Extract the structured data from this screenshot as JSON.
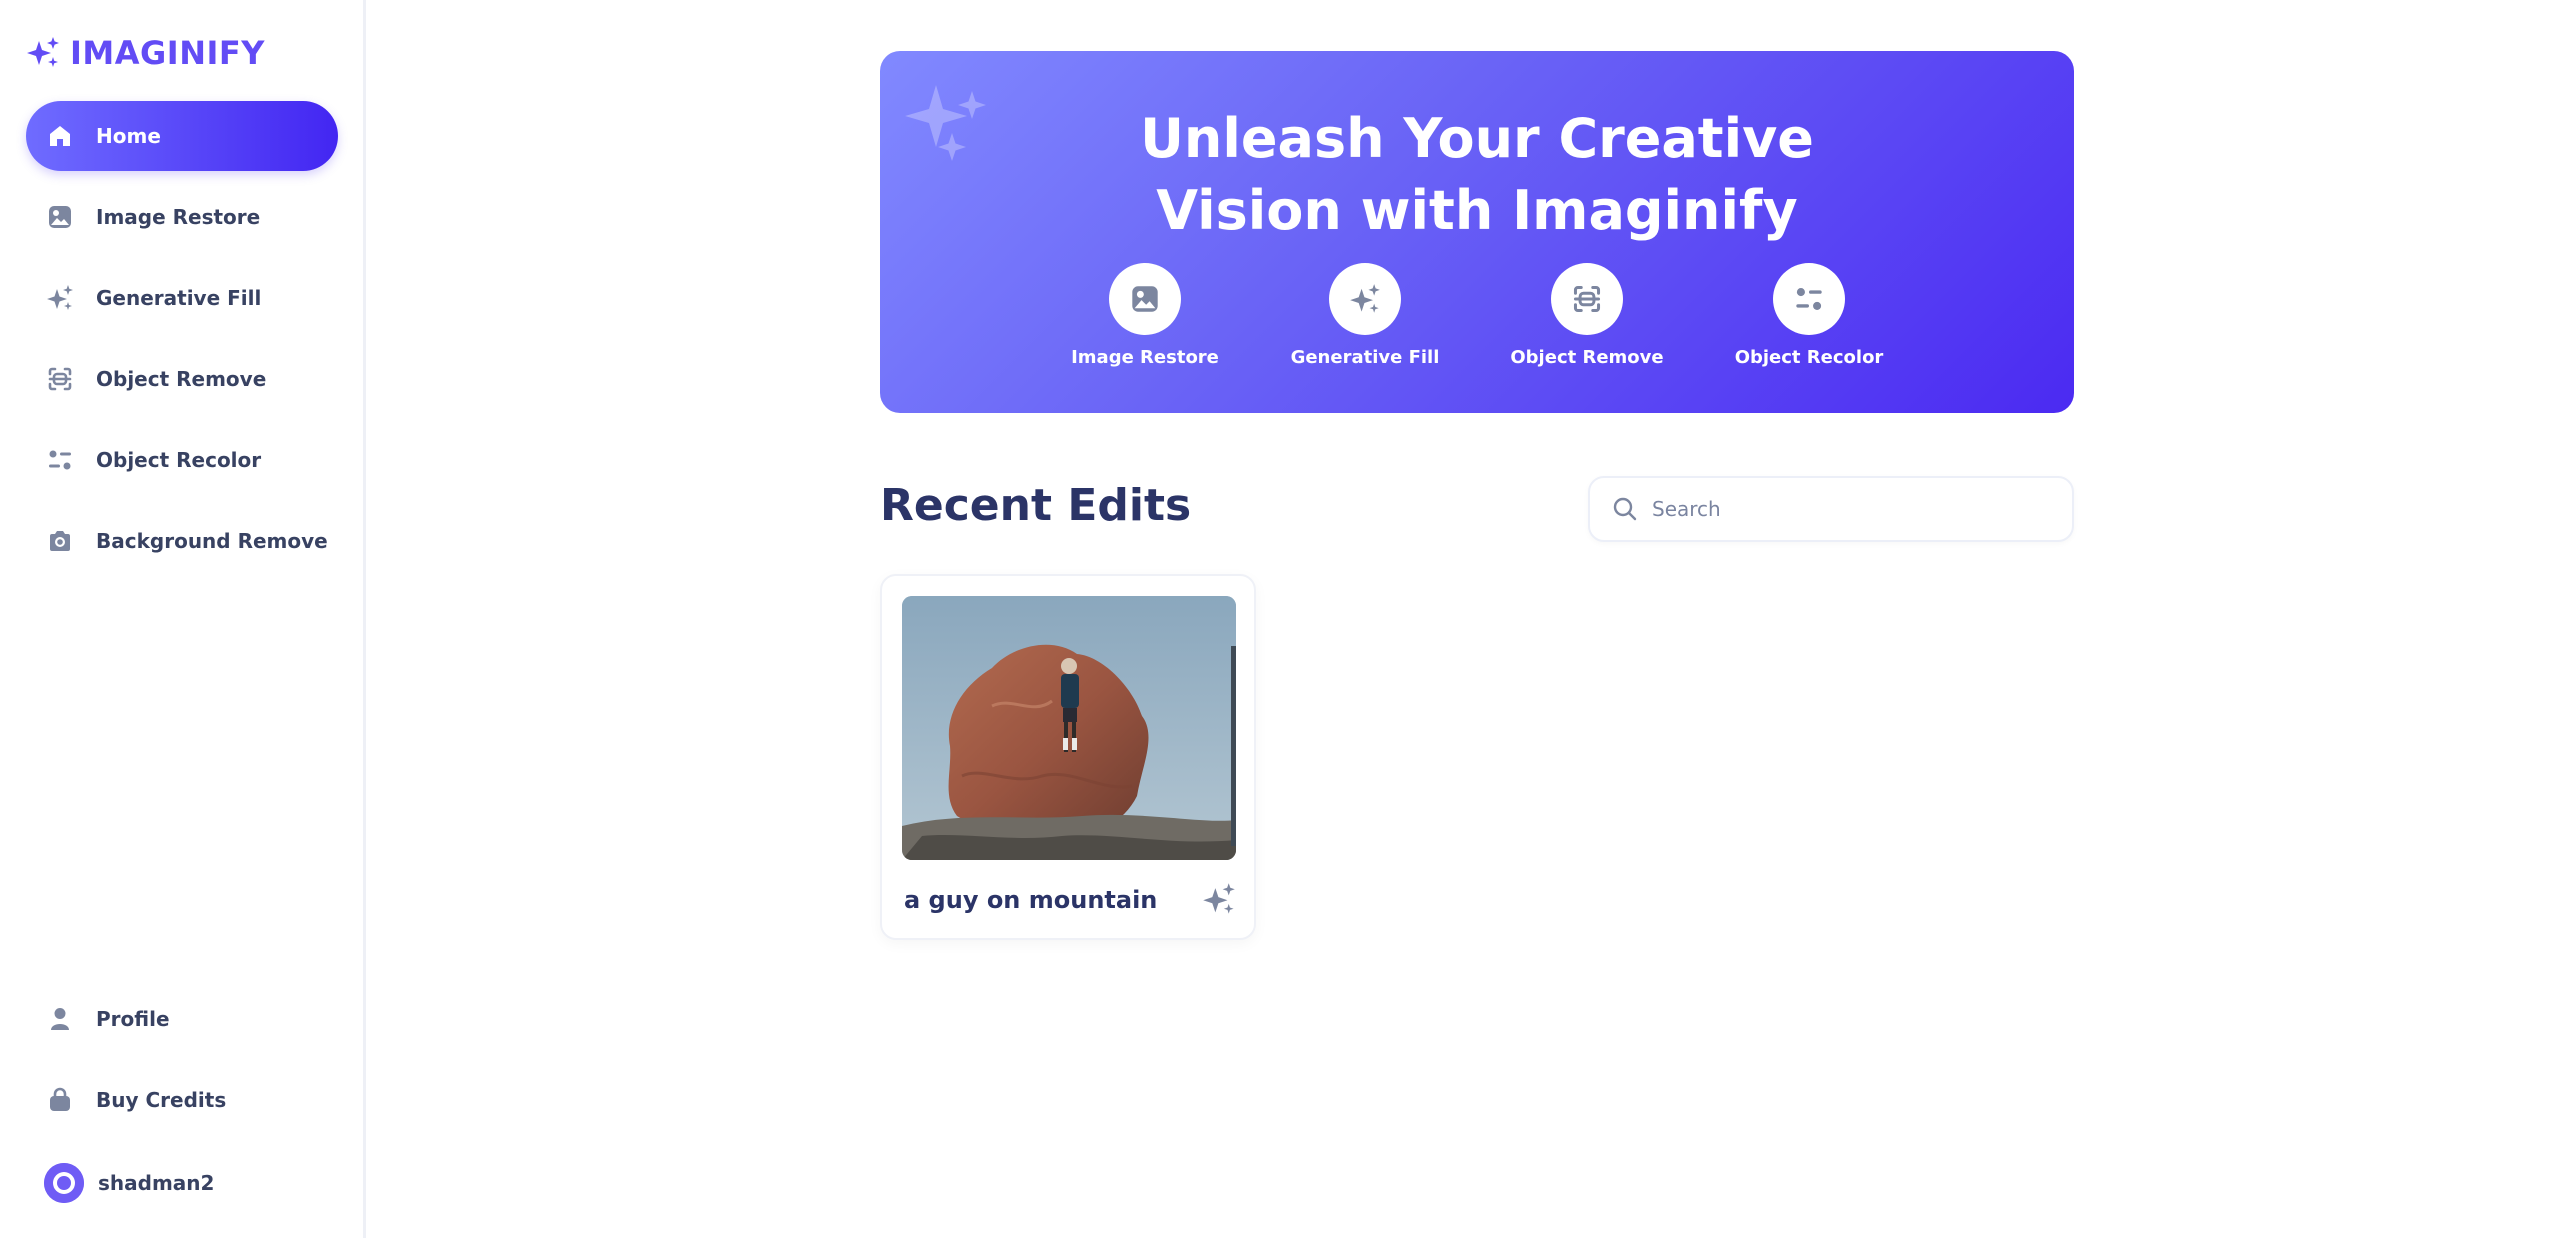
{
  "brand": {
    "name": "IMAGINIFY",
    "accent": "#624cf5"
  },
  "sidebar": {
    "items": [
      {
        "label": "Home",
        "icon": "home-icon",
        "active": true
      },
      {
        "label": "Image Restore",
        "icon": "image-icon",
        "active": false
      },
      {
        "label": "Generative Fill",
        "icon": "stars-icon",
        "active": false
      },
      {
        "label": "Object Remove",
        "icon": "scan-icon",
        "active": false
      },
      {
        "label": "Object Recolor",
        "icon": "filter-icon",
        "active": false
      },
      {
        "label": "Background Remove",
        "icon": "camera-icon",
        "active": false
      }
    ],
    "bottom_items": [
      {
        "label": "Profile",
        "icon": "profile-icon"
      },
      {
        "label": "Buy Credits",
        "icon": "bag-icon"
      }
    ],
    "user": {
      "name": "shadman2"
    }
  },
  "hero": {
    "title_line1": "Unleash Your Creative",
    "title_line2": "Vision with Imaginify",
    "links": [
      {
        "label": "Image Restore",
        "icon": "image-icon"
      },
      {
        "label": "Generative Fill",
        "icon": "stars-icon"
      },
      {
        "label": "Object Remove",
        "icon": "scan-icon"
      },
      {
        "label": "Object Recolor",
        "icon": "filter-icon"
      }
    ]
  },
  "recent": {
    "title": "Recent Edits",
    "search_placeholder": "Search",
    "items": [
      {
        "title": "a guy on mountain",
        "icon": "stars-icon"
      }
    ]
  }
}
